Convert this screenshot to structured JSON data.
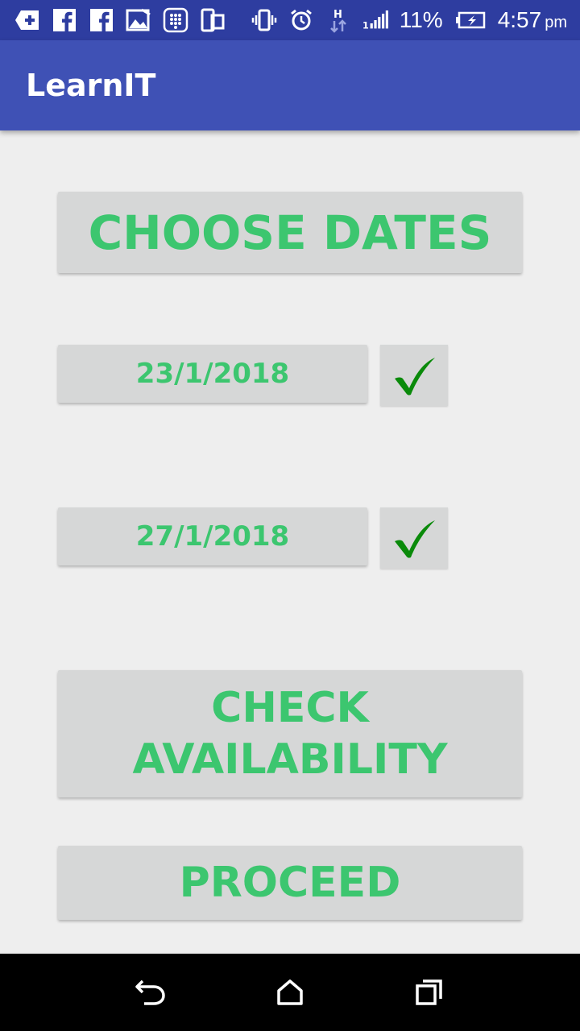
{
  "status_bar": {
    "battery_percent": "11%",
    "time": "4:57",
    "ampm": "pm"
  },
  "app_bar": {
    "title": "LearnIT"
  },
  "main": {
    "choose_dates_label": "CHOOSE DATES",
    "date_start": "23/1/2018",
    "date_end": "27/1/2018",
    "check_availability_line1": "CHECK",
    "check_availability_line2": "AVAILABILITY",
    "proceed_label": "PROCEED"
  },
  "colors": {
    "status_bar": "#2e3da0",
    "app_bar": "#3f51b5",
    "button_bg": "#d6d7d7",
    "button_text": "#3cc66f",
    "checkmark": "#0a8a0a",
    "background": "#eeeeee"
  },
  "icons": {
    "status_left": [
      "add-box-icon",
      "facebook-icon",
      "facebook-icon",
      "gallery-icon",
      "dialpad-icon",
      "screen-mirror-icon"
    ],
    "status_right": [
      "vibrate-icon",
      "alarm-icon",
      "data-h-icon",
      "signal-icon",
      "battery-charging-icon"
    ],
    "nav": [
      "back-icon",
      "home-icon",
      "recents-icon"
    ]
  }
}
